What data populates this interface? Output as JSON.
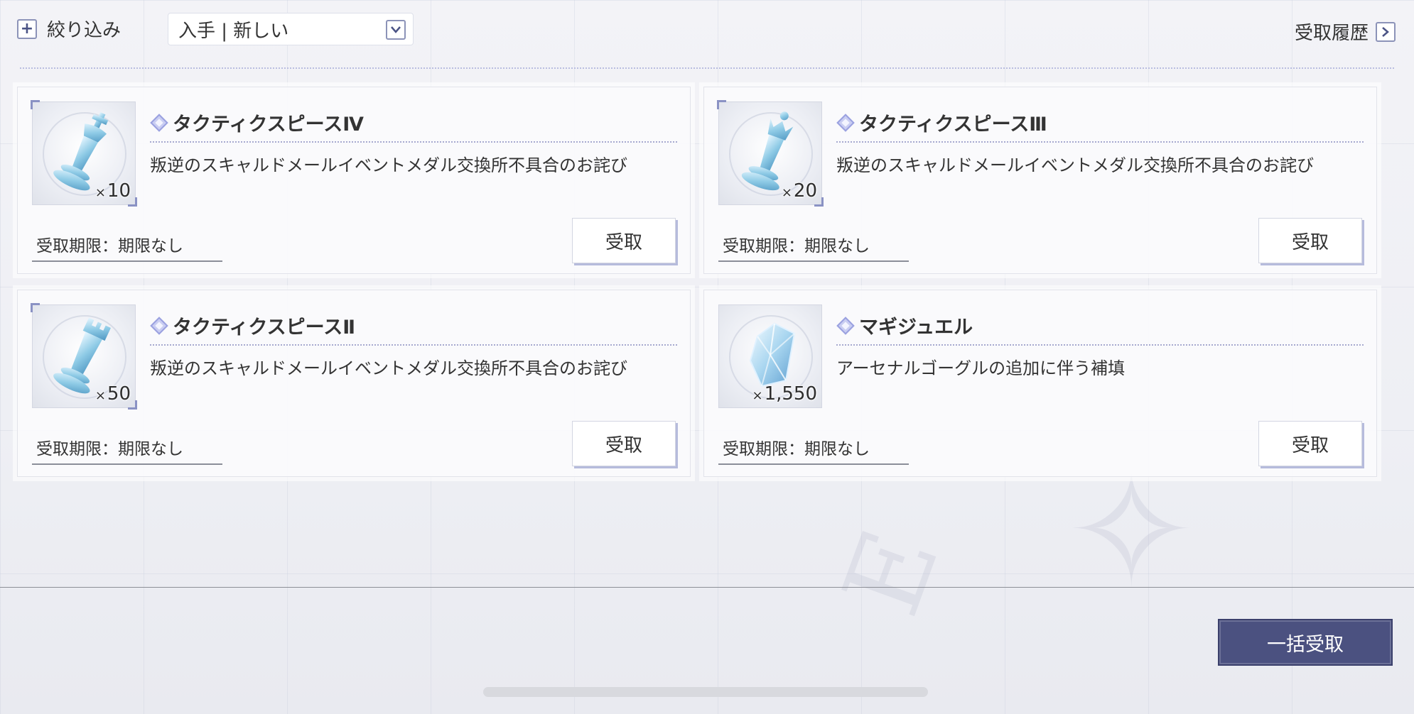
{
  "topbar": {
    "filter_label": "絞り込み",
    "sort_value": "入手 | 新しい",
    "history_label": "受取履歴"
  },
  "items": [
    {
      "name": "タクティクスピースⅣ",
      "description": "叛逆のスキャルドメールイベントメダル交換所不具合のお詫び",
      "quantity": "10",
      "deadline": "受取期限：期限なし",
      "button": "受取",
      "icon": "chess-king-icon"
    },
    {
      "name": "タクティクスピースⅢ",
      "description": "叛逆のスキャルドメールイベントメダル交換所不具合のお詫び",
      "quantity": "20",
      "deadline": "受取期限：期限なし",
      "button": "受取",
      "icon": "chess-queen-icon"
    },
    {
      "name": "タクティクスピースⅡ",
      "description": "叛逆のスキャルドメールイベントメダル交換所不具合のお詫び",
      "quantity": "50",
      "deadline": "受取期限：期限なし",
      "button": "受取",
      "icon": "chess-rook-icon"
    },
    {
      "name": "マギジュエル",
      "description": "アーセナルゴーグルの追加に伴う補填",
      "quantity": "1,550",
      "deadline": "受取期限：期限なし",
      "button": "受取",
      "icon": "crystal-gem-icon"
    }
  ],
  "qty_prefix": "×",
  "bulk_button": "一括受取"
}
